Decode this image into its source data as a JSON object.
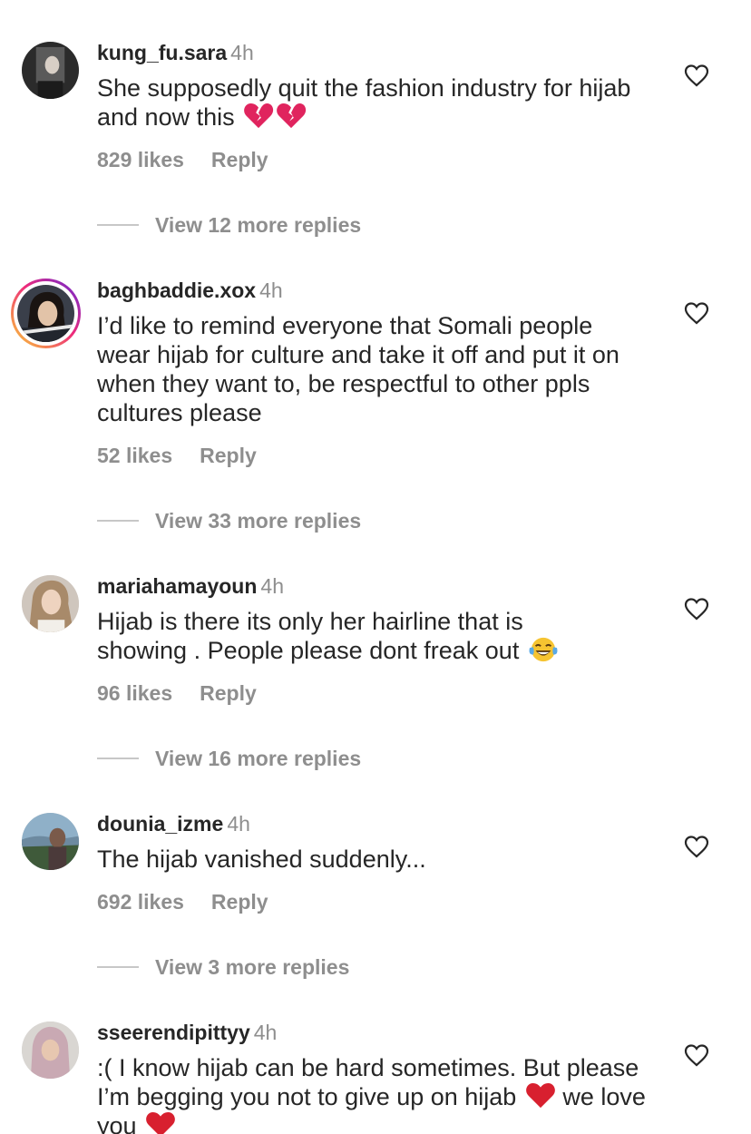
{
  "comments": [
    {
      "username": "kung_fu.sara",
      "time": "4h",
      "text": "She supposedly quit the fashion industry for hijab and now this",
      "emoji": [
        "broken-heart-icon",
        "broken-heart-icon"
      ],
      "likes": "829 likes",
      "reply": "Reply",
      "more_replies": "View 12 more replies",
      "story_ring": false
    },
    {
      "username": "baghbaddie.xox",
      "time": "4h",
      "text": "I’d like to remind everyone that Somali people wear hijab for culture and take it off and put it on when they want to, be respectful to other ppls cultures please",
      "likes": "52 likes",
      "reply": "Reply",
      "more_replies": "View 33 more replies",
      "story_ring": true
    },
    {
      "username": "mariahamayoun",
      "time": "4h",
      "text": "Hijab is there its only her hairline that is showing . People please dont freak out",
      "emoji": [
        "tears-of-joy-icon"
      ],
      "likes": "96 likes",
      "reply": "Reply",
      "more_replies": "View 16 more replies",
      "story_ring": false
    },
    {
      "username": "dounia_izme",
      "time": "4h",
      "text": "The hijab vanished suddenly...",
      "likes": "692 likes",
      "reply": "Reply",
      "more_replies": "View 3 more replies",
      "story_ring": false
    },
    {
      "username": "sseerendipittyy",
      "time": "4h",
      "text_parts": [
        ":( I know hijab can be hard sometimes. But please I’m begging you not to give up on hijab",
        "we love you"
      ],
      "emoji": [
        "red-heart-icon",
        "red-heart-icon"
      ],
      "story_ring": false
    }
  ],
  "colors": {
    "text": "#262626",
    "secondary": "#8e8e8e",
    "divider": "#c7c7c7",
    "broken_heart": "#e0245e",
    "red_heart": "#d8202f"
  }
}
